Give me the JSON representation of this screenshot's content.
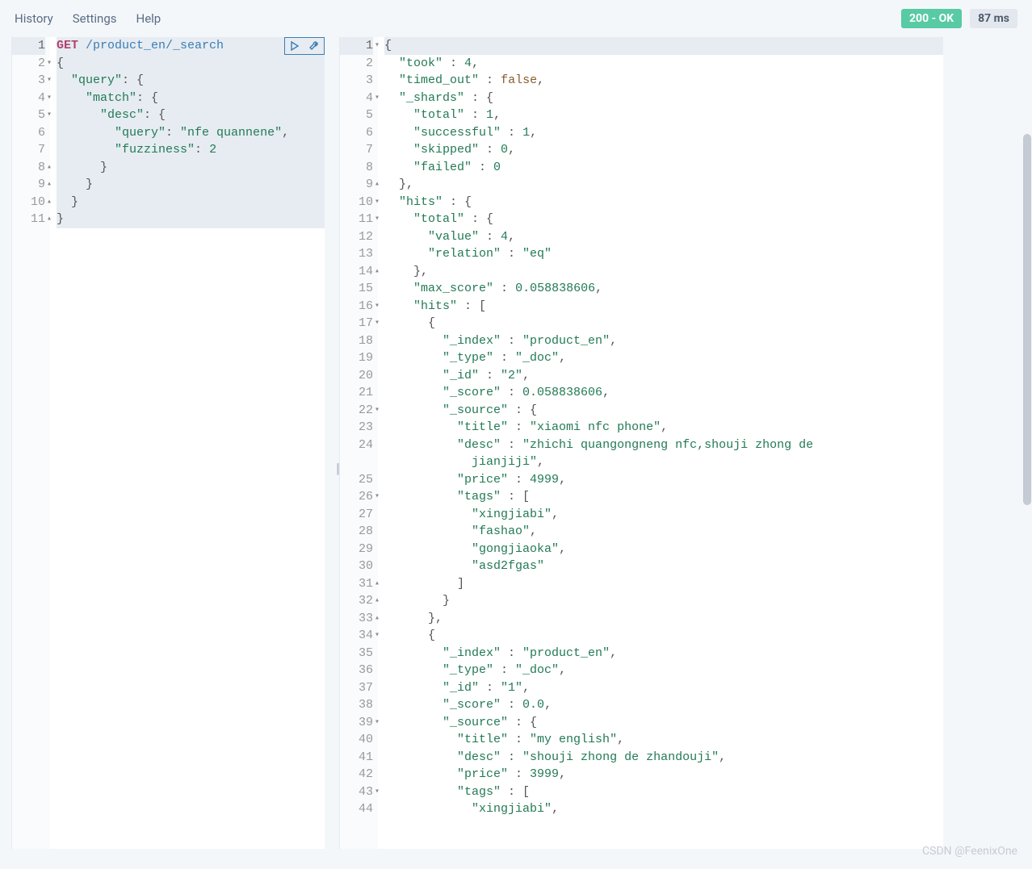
{
  "topbar": {
    "history": "History",
    "settings": "Settings",
    "help": "Help",
    "status": "200 - OK",
    "time": "87 ms"
  },
  "request": {
    "method": "GET",
    "path": "/product_en/_search",
    "lines": [
      {
        "n": "1",
        "fold": "",
        "txt": [
          [
            "kw-get",
            "GET"
          ],
          [
            "plain",
            " "
          ],
          [
            "req-path",
            "/product_en/_search"
          ]
        ],
        "hilite": true
      },
      {
        "n": "2",
        "fold": "▾",
        "txt": [
          [
            "punct",
            "{"
          ]
        ]
      },
      {
        "n": "3",
        "fold": "▾",
        "txt": [
          [
            "plain",
            "  "
          ],
          [
            "prop",
            "\"query\""
          ],
          [
            "punct",
            ": {"
          ]
        ]
      },
      {
        "n": "4",
        "fold": "▾",
        "txt": [
          [
            "plain",
            "    "
          ],
          [
            "prop",
            "\"match\""
          ],
          [
            "punct",
            ": {"
          ]
        ]
      },
      {
        "n": "5",
        "fold": "▾",
        "txt": [
          [
            "plain",
            "      "
          ],
          [
            "prop",
            "\"desc\""
          ],
          [
            "punct",
            ": {"
          ]
        ]
      },
      {
        "n": "6",
        "fold": "",
        "txt": [
          [
            "plain",
            "        "
          ],
          [
            "prop",
            "\"query\""
          ],
          [
            "punct",
            ": "
          ],
          [
            "str",
            "\"nfe quannene\""
          ],
          [
            "punct",
            ","
          ]
        ]
      },
      {
        "n": "7",
        "fold": "",
        "txt": [
          [
            "plain",
            "        "
          ],
          [
            "prop",
            "\"fuzziness\""
          ],
          [
            "punct",
            ": "
          ],
          [
            "num",
            "2"
          ]
        ]
      },
      {
        "n": "8",
        "fold": "▴",
        "txt": [
          [
            "plain",
            "      "
          ],
          [
            "punct",
            "}"
          ]
        ]
      },
      {
        "n": "9",
        "fold": "▴",
        "txt": [
          [
            "plain",
            "    "
          ],
          [
            "punct",
            "}"
          ]
        ]
      },
      {
        "n": "10",
        "fold": "▴",
        "txt": [
          [
            "plain",
            "  "
          ],
          [
            "punct",
            "}"
          ]
        ]
      },
      {
        "n": "11",
        "fold": "▴",
        "txt": [
          [
            "punct",
            "}"
          ]
        ]
      }
    ]
  },
  "response": {
    "lines": [
      {
        "n": "1",
        "fold": "▾",
        "txt": [
          [
            "punct",
            "{"
          ]
        ],
        "hilite": true
      },
      {
        "n": "2",
        "fold": "",
        "txt": [
          [
            "plain",
            "  "
          ],
          [
            "prop",
            "\"took\""
          ],
          [
            "punct",
            " : "
          ],
          [
            "num",
            "4"
          ],
          [
            "punct",
            ","
          ]
        ]
      },
      {
        "n": "3",
        "fold": "",
        "txt": [
          [
            "plain",
            "  "
          ],
          [
            "prop",
            "\"timed_out\""
          ],
          [
            "punct",
            " : "
          ],
          [
            "bool",
            "false"
          ],
          [
            "punct",
            ","
          ]
        ]
      },
      {
        "n": "4",
        "fold": "▾",
        "txt": [
          [
            "plain",
            "  "
          ],
          [
            "prop",
            "\"_shards\""
          ],
          [
            "punct",
            " : {"
          ]
        ]
      },
      {
        "n": "5",
        "fold": "",
        "txt": [
          [
            "plain",
            "    "
          ],
          [
            "prop",
            "\"total\""
          ],
          [
            "punct",
            " : "
          ],
          [
            "num",
            "1"
          ],
          [
            "punct",
            ","
          ]
        ]
      },
      {
        "n": "6",
        "fold": "",
        "txt": [
          [
            "plain",
            "    "
          ],
          [
            "prop",
            "\"successful\""
          ],
          [
            "punct",
            " : "
          ],
          [
            "num",
            "1"
          ],
          [
            "punct",
            ","
          ]
        ]
      },
      {
        "n": "7",
        "fold": "",
        "txt": [
          [
            "plain",
            "    "
          ],
          [
            "prop",
            "\"skipped\""
          ],
          [
            "punct",
            " : "
          ],
          [
            "num",
            "0"
          ],
          [
            "punct",
            ","
          ]
        ]
      },
      {
        "n": "8",
        "fold": "",
        "txt": [
          [
            "plain",
            "    "
          ],
          [
            "prop",
            "\"failed\""
          ],
          [
            "punct",
            " : "
          ],
          [
            "num",
            "0"
          ]
        ]
      },
      {
        "n": "9",
        "fold": "▴",
        "txt": [
          [
            "plain",
            "  "
          ],
          [
            "punct",
            "},"
          ]
        ]
      },
      {
        "n": "10",
        "fold": "▾",
        "txt": [
          [
            "plain",
            "  "
          ],
          [
            "prop",
            "\"hits\""
          ],
          [
            "punct",
            " : {"
          ]
        ]
      },
      {
        "n": "11",
        "fold": "▾",
        "txt": [
          [
            "plain",
            "    "
          ],
          [
            "prop",
            "\"total\""
          ],
          [
            "punct",
            " : {"
          ]
        ]
      },
      {
        "n": "12",
        "fold": "",
        "txt": [
          [
            "plain",
            "      "
          ],
          [
            "prop",
            "\"value\""
          ],
          [
            "punct",
            " : "
          ],
          [
            "num",
            "4"
          ],
          [
            "punct",
            ","
          ]
        ]
      },
      {
        "n": "13",
        "fold": "",
        "txt": [
          [
            "plain",
            "      "
          ],
          [
            "prop",
            "\"relation\""
          ],
          [
            "punct",
            " : "
          ],
          [
            "str",
            "\"eq\""
          ]
        ]
      },
      {
        "n": "14",
        "fold": "▴",
        "txt": [
          [
            "plain",
            "    "
          ],
          [
            "punct",
            "},"
          ]
        ]
      },
      {
        "n": "15",
        "fold": "",
        "txt": [
          [
            "plain",
            "    "
          ],
          [
            "prop",
            "\"max_score\""
          ],
          [
            "punct",
            " : "
          ],
          [
            "num",
            "0.058838606"
          ],
          [
            "punct",
            ","
          ]
        ]
      },
      {
        "n": "16",
        "fold": "▾",
        "txt": [
          [
            "plain",
            "    "
          ],
          [
            "prop",
            "\"hits\""
          ],
          [
            "punct",
            " : ["
          ]
        ]
      },
      {
        "n": "17",
        "fold": "▾",
        "txt": [
          [
            "plain",
            "      "
          ],
          [
            "punct",
            "{"
          ]
        ]
      },
      {
        "n": "18",
        "fold": "",
        "txt": [
          [
            "plain",
            "        "
          ],
          [
            "prop",
            "\"_index\""
          ],
          [
            "punct",
            " : "
          ],
          [
            "str",
            "\"product_en\""
          ],
          [
            "punct",
            ","
          ]
        ]
      },
      {
        "n": "19",
        "fold": "",
        "txt": [
          [
            "plain",
            "        "
          ],
          [
            "prop",
            "\"_type\""
          ],
          [
            "punct",
            " : "
          ],
          [
            "str",
            "\"_doc\""
          ],
          [
            "punct",
            ","
          ]
        ]
      },
      {
        "n": "20",
        "fold": "",
        "txt": [
          [
            "plain",
            "        "
          ],
          [
            "prop",
            "\"_id\""
          ],
          [
            "punct",
            " : "
          ],
          [
            "str",
            "\"2\""
          ],
          [
            "punct",
            ","
          ]
        ]
      },
      {
        "n": "21",
        "fold": "",
        "txt": [
          [
            "plain",
            "        "
          ],
          [
            "prop",
            "\"_score\""
          ],
          [
            "punct",
            " : "
          ],
          [
            "num",
            "0.058838606"
          ],
          [
            "punct",
            ","
          ]
        ]
      },
      {
        "n": "22",
        "fold": "▾",
        "txt": [
          [
            "plain",
            "        "
          ],
          [
            "prop",
            "\"_source\""
          ],
          [
            "punct",
            " : {"
          ]
        ]
      },
      {
        "n": "23",
        "fold": "",
        "txt": [
          [
            "plain",
            "          "
          ],
          [
            "prop",
            "\"title\""
          ],
          [
            "punct",
            " : "
          ],
          [
            "str",
            "\"xiaomi nfc phone\""
          ],
          [
            "punct",
            ","
          ]
        ]
      },
      {
        "n": "24",
        "fold": "",
        "txt": [
          [
            "plain",
            "          "
          ],
          [
            "prop",
            "\"desc\""
          ],
          [
            "punct",
            " : "
          ],
          [
            "str",
            "\"zhichi quangongneng nfc,shouji zhong de "
          ]
        ]
      },
      {
        "n": "",
        "fold": "",
        "txt": [
          [
            "plain",
            "            "
          ],
          [
            "str",
            "jianjiji\""
          ],
          [
            "punct",
            ","
          ]
        ]
      },
      {
        "n": "25",
        "fold": "",
        "txt": [
          [
            "plain",
            "          "
          ],
          [
            "prop",
            "\"price\""
          ],
          [
            "punct",
            " : "
          ],
          [
            "num",
            "4999"
          ],
          [
            "punct",
            ","
          ]
        ]
      },
      {
        "n": "26",
        "fold": "▾",
        "txt": [
          [
            "plain",
            "          "
          ],
          [
            "prop",
            "\"tags\""
          ],
          [
            "punct",
            " : ["
          ]
        ]
      },
      {
        "n": "27",
        "fold": "",
        "txt": [
          [
            "plain",
            "            "
          ],
          [
            "str",
            "\"xingjiabi\""
          ],
          [
            "punct",
            ","
          ]
        ]
      },
      {
        "n": "28",
        "fold": "",
        "txt": [
          [
            "plain",
            "            "
          ],
          [
            "str",
            "\"fashao\""
          ],
          [
            "punct",
            ","
          ]
        ]
      },
      {
        "n": "29",
        "fold": "",
        "txt": [
          [
            "plain",
            "            "
          ],
          [
            "str",
            "\"gongjiaoka\""
          ],
          [
            "punct",
            ","
          ]
        ]
      },
      {
        "n": "30",
        "fold": "",
        "txt": [
          [
            "plain",
            "            "
          ],
          [
            "str",
            "\"asd2fgas\""
          ]
        ]
      },
      {
        "n": "31",
        "fold": "▴",
        "txt": [
          [
            "plain",
            "          "
          ],
          [
            "punct",
            "]"
          ]
        ]
      },
      {
        "n": "32",
        "fold": "▴",
        "txt": [
          [
            "plain",
            "        "
          ],
          [
            "punct",
            "}"
          ]
        ]
      },
      {
        "n": "33",
        "fold": "▴",
        "txt": [
          [
            "plain",
            "      "
          ],
          [
            "punct",
            "},"
          ]
        ]
      },
      {
        "n": "34",
        "fold": "▾",
        "txt": [
          [
            "plain",
            "      "
          ],
          [
            "punct",
            "{"
          ]
        ]
      },
      {
        "n": "35",
        "fold": "",
        "txt": [
          [
            "plain",
            "        "
          ],
          [
            "prop",
            "\"_index\""
          ],
          [
            "punct",
            " : "
          ],
          [
            "str",
            "\"product_en\""
          ],
          [
            "punct",
            ","
          ]
        ]
      },
      {
        "n": "36",
        "fold": "",
        "txt": [
          [
            "plain",
            "        "
          ],
          [
            "prop",
            "\"_type\""
          ],
          [
            "punct",
            " : "
          ],
          [
            "str",
            "\"_doc\""
          ],
          [
            "punct",
            ","
          ]
        ]
      },
      {
        "n": "37",
        "fold": "",
        "txt": [
          [
            "plain",
            "        "
          ],
          [
            "prop",
            "\"_id\""
          ],
          [
            "punct",
            " : "
          ],
          [
            "str",
            "\"1\""
          ],
          [
            "punct",
            ","
          ]
        ]
      },
      {
        "n": "38",
        "fold": "",
        "txt": [
          [
            "plain",
            "        "
          ],
          [
            "prop",
            "\"_score\""
          ],
          [
            "punct",
            " : "
          ],
          [
            "num",
            "0.0"
          ],
          [
            "punct",
            ","
          ]
        ]
      },
      {
        "n": "39",
        "fold": "▾",
        "txt": [
          [
            "plain",
            "        "
          ],
          [
            "prop",
            "\"_source\""
          ],
          [
            "punct",
            " : {"
          ]
        ]
      },
      {
        "n": "40",
        "fold": "",
        "txt": [
          [
            "plain",
            "          "
          ],
          [
            "prop",
            "\"title\""
          ],
          [
            "punct",
            " : "
          ],
          [
            "str",
            "\"my english\""
          ],
          [
            "punct",
            ","
          ]
        ]
      },
      {
        "n": "41",
        "fold": "",
        "txt": [
          [
            "plain",
            "          "
          ],
          [
            "prop",
            "\"desc\""
          ],
          [
            "punct",
            " : "
          ],
          [
            "str",
            "\"shouji zhong de zhandouji\""
          ],
          [
            "punct",
            ","
          ]
        ]
      },
      {
        "n": "42",
        "fold": "",
        "txt": [
          [
            "plain",
            "          "
          ],
          [
            "prop",
            "\"price\""
          ],
          [
            "punct",
            " : "
          ],
          [
            "num",
            "3999"
          ],
          [
            "punct",
            ","
          ]
        ]
      },
      {
        "n": "43",
        "fold": "▾",
        "txt": [
          [
            "plain",
            "          "
          ],
          [
            "prop",
            "\"tags\""
          ],
          [
            "punct",
            " : ["
          ]
        ]
      },
      {
        "n": "44",
        "fold": "",
        "txt": [
          [
            "plain",
            "            "
          ],
          [
            "str",
            "\"xingjiabi\""
          ],
          [
            "punct",
            ","
          ]
        ]
      }
    ]
  },
  "watermark": "CSDN @FeenixOne"
}
